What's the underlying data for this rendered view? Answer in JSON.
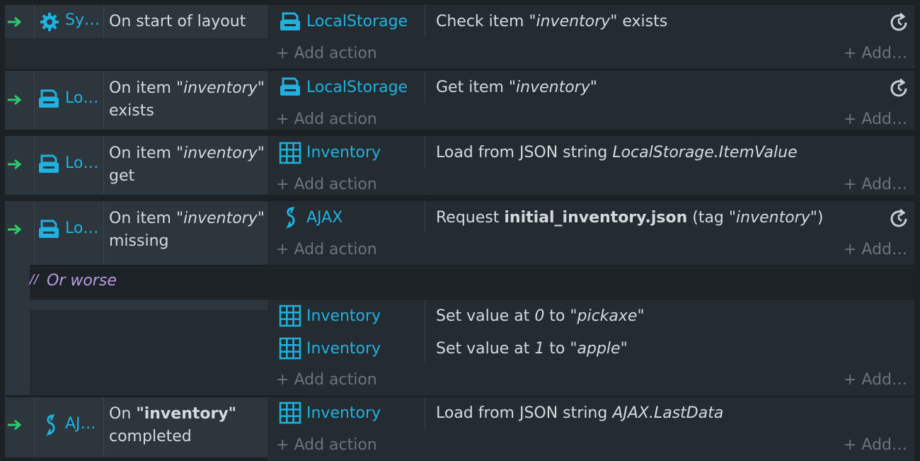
{
  "events": [
    {
      "object_short": "Sy…",
      "object_icon": "gear-icon",
      "condition": {
        "pre": "On start of layout",
        "quote": "",
        "post": ""
      },
      "actions": [
        {
          "object": "LocalStorage",
          "icon": "storage-icon",
          "text": {
            "pre": "Check item ",
            "q": "\"inventory\"",
            "post": " exists"
          },
          "reload": true
        }
      ],
      "add_action": "Add action",
      "add_right": "Add…"
    },
    {
      "object_short": "Lo…",
      "object_icon": "storage-icon",
      "condition": {
        "line1_pre": "On item ",
        "line1_q": "\"inventory\"",
        "line2": "exists"
      },
      "actions": [
        {
          "object": "LocalStorage",
          "icon": "storage-icon",
          "text": {
            "pre": "Get item ",
            "q": "\"inventory\"",
            "post": ""
          },
          "reload": true
        }
      ],
      "add_action": "Add action",
      "add_right": "Add…"
    },
    {
      "object_short": "Lo…",
      "object_icon": "storage-icon",
      "condition": {
        "line1_pre": "On item ",
        "line1_q": "\"inventory\"",
        "line2": "get"
      },
      "actions": [
        {
          "object": "Inventory",
          "icon": "grid-icon",
          "text": {
            "pre": "Load from JSON string ",
            "q": "LocalStorage.ItemValue",
            "post": ""
          },
          "reload": false
        }
      ],
      "add_action": "Add action",
      "add_right": "Add…"
    },
    {
      "object_short": "Lo…",
      "object_icon": "storage-icon",
      "condition": {
        "line1_pre": "On item ",
        "line1_q": "\"inventory\"",
        "line2": "missing"
      },
      "actions": [
        {
          "object": "AJAX",
          "icon": "ajax-icon",
          "text": {
            "pre": "Request ",
            "bold": "initial_inventory.json",
            "mid": " (tag ",
            "q": "\"inventory\"",
            "post": ")"
          },
          "reload": true
        }
      ],
      "add_action": "Add action",
      "add_right": "Add…"
    }
  ],
  "comment": "Or worse",
  "sub_event": {
    "actions": [
      {
        "object": "Inventory",
        "icon": "grid-icon",
        "pre": "Set value at ",
        "idx": "0",
        "mid": " to ",
        "q": "\"pickaxe\""
      },
      {
        "object": "Inventory",
        "icon": "grid-icon",
        "pre": "Set value at ",
        "idx": "1",
        "mid": " to ",
        "q": "\"apple\""
      }
    ],
    "add_action": "Add action",
    "add_right": "Add…"
  },
  "last_event": {
    "object_short": "AJ…",
    "object_icon": "ajax-icon",
    "condition": {
      "pre": "On ",
      "bold": "\"inventory\"",
      "line2": "completed"
    },
    "action": {
      "object": "Inventory",
      "icon": "grid-icon",
      "pre": "Load from JSON string ",
      "q": "AJAX.LastData"
    },
    "add_action": "Add action",
    "add_right": "Add…"
  },
  "colors": {
    "object_name": "#1fb2e0",
    "arrow": "#2ecc71",
    "comment": "#b89be8",
    "muted": "#6a747b"
  }
}
